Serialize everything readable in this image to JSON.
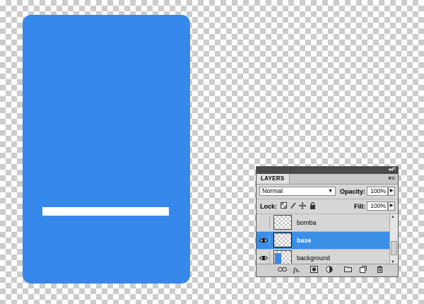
{
  "canvas": {
    "card_color": "#3688eb",
    "bar_color": "#ffffff"
  },
  "panel": {
    "tab_label": "LAYERS",
    "blend_mode": "Normal",
    "opacity_label": "Opacity:",
    "opacity_value": "100%",
    "lock_label": "Lock:",
    "fill_label": "Fill:",
    "fill_value": "100%",
    "icons": [
      "collapse-icon",
      "close-icon",
      "panel-menu-icon",
      "lock-transparent-icon",
      "lock-brush-icon",
      "lock-move-icon",
      "lock-all-icon"
    ],
    "layers": [
      {
        "name": "bomba",
        "visible": false,
        "selected": false,
        "thumb": "transparent"
      },
      {
        "name": "base",
        "visible": true,
        "selected": true,
        "thumb": "transparent"
      },
      {
        "name": "background",
        "visible": true,
        "selected": false,
        "thumb": "blue"
      }
    ],
    "selected_color": "#3b8fe6",
    "footer_icons": [
      "link-layers-icon",
      "fx-icon",
      "layer-mask-icon",
      "adjustment-layer-icon",
      "new-group-icon",
      "new-layer-icon",
      "delete-layer-icon"
    ]
  }
}
